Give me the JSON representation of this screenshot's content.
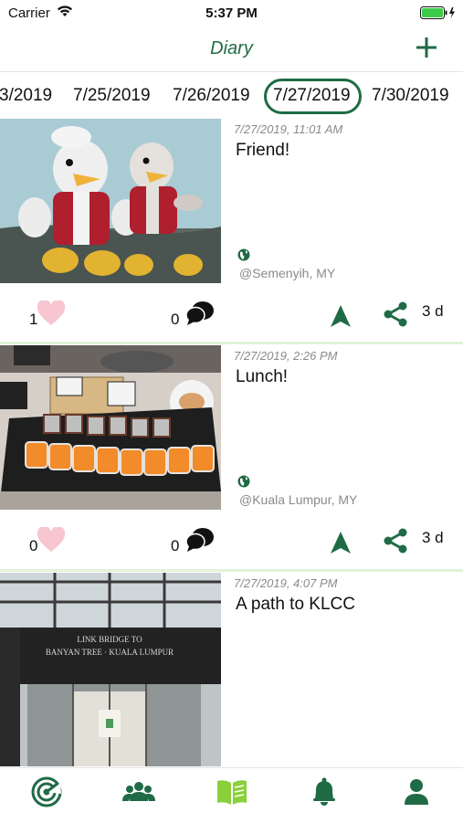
{
  "status_bar": {
    "carrier": "Carrier",
    "time": "5:37 PM"
  },
  "header": {
    "title": "Diary",
    "add_icon": "plus-icon"
  },
  "date_strip": {
    "dates": [
      "3/2019",
      "7/25/2019",
      "7/26/2019",
      "7/27/2019",
      "7/30/2019"
    ],
    "selected": "7/27/2019"
  },
  "posts": [
    {
      "timestamp": "7/27/2019, 11:01 AM",
      "title": "Friend!",
      "location": "@Semenyih, MY",
      "likes": "1",
      "comments": "0",
      "age": "3 d",
      "photo": "two plush birds"
    },
    {
      "timestamp": "7/27/2019, 2:26 PM",
      "title": "Lunch!",
      "location": "@Kuala Lumpur, MY",
      "likes": "0",
      "comments": "0",
      "age": "3 d",
      "photo": "sushi platter"
    },
    {
      "timestamp": "7/27/2019, 4:07 PM",
      "title": "A path to KLCC",
      "photo": "glass walkway",
      "sign_line1": "LINK BRIDGE TO",
      "sign_line2": "BANYAN TREE · KUALA LUMPUR"
    }
  ],
  "tab_bar": {
    "tabs": [
      "radar-icon",
      "people-icon",
      "book-icon",
      "bell-icon",
      "profile-icon"
    ],
    "active": "book-icon"
  },
  "colors": {
    "accent": "#1f6b45",
    "active_tab": "#8ad03b",
    "heart": "#f7c6d0",
    "divider": "#dff3d8"
  }
}
